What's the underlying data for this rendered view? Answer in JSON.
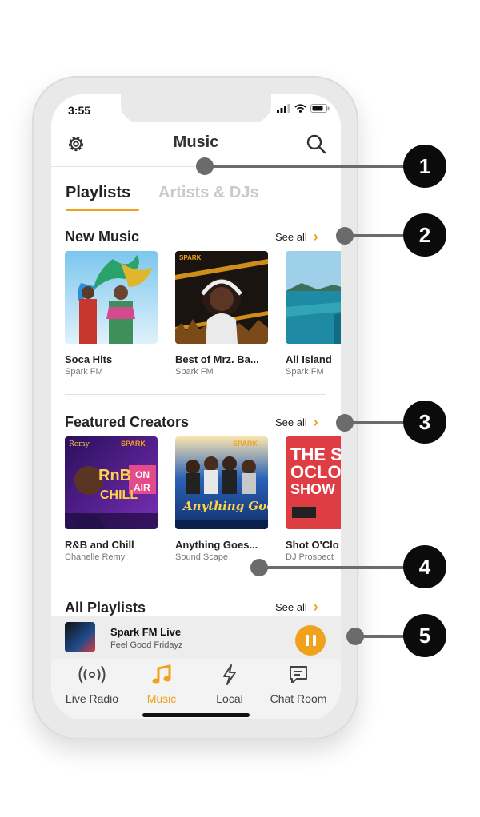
{
  "status": {
    "time": "3:55"
  },
  "header": {
    "title": "Music"
  },
  "tabs": [
    {
      "label": "Playlists"
    },
    {
      "label": "Artists & DJs"
    }
  ],
  "sections": [
    {
      "title": "New Music",
      "see_all": "See all",
      "cards": [
        {
          "title": "Soca Hits",
          "subtitle": "Spark FM"
        },
        {
          "title": "Best of Mrz. Ba...",
          "subtitle": "Spark FM"
        },
        {
          "title": "All Island",
          "subtitle": "Spark FM"
        }
      ]
    },
    {
      "title": "Featured Creators",
      "see_all": "See all",
      "cards": [
        {
          "title": "R&B and Chill",
          "subtitle": "Chanelle Remy"
        },
        {
          "title": "Anything Goes...",
          "subtitle": "Sound Scape"
        },
        {
          "title": "Shot O'Clo",
          "subtitle": "DJ Prospect"
        }
      ]
    },
    {
      "title": "All Playlists",
      "see_all": "See all"
    }
  ],
  "artwork_text": {
    "rnb_top": "Remy",
    "rnb_brand": "SPARK",
    "rnb_line1": "RnB",
    "rnb_line2": "CHILL",
    "rnb_on": "ON",
    "rnb_air": "AIR",
    "anything_brand": "SPARK",
    "anything_title": "Anything Goes",
    "shot_line1": "THE SH",
    "shot_line2": "OCLOC",
    "shot_line3": "SHOW",
    "mrz_brand": "SPARK"
  },
  "mini_player": {
    "title": "Spark FM Live",
    "subtitle": "Feel Good Fridayz"
  },
  "tabbar": [
    {
      "label": "Live Radio",
      "icon": "radio-icon"
    },
    {
      "label": "Music",
      "icon": "music-note-icon",
      "active": true
    },
    {
      "label": "Local",
      "icon": "lightning-icon"
    },
    {
      "label": "Chat Room",
      "icon": "chat-icon"
    }
  ],
  "callouts": [
    "1",
    "2",
    "3",
    "4",
    "5"
  ],
  "colors": {
    "accent": "#f0a21c",
    "callout": "#0b0b0b",
    "callout_line": "#6b6b6b"
  }
}
